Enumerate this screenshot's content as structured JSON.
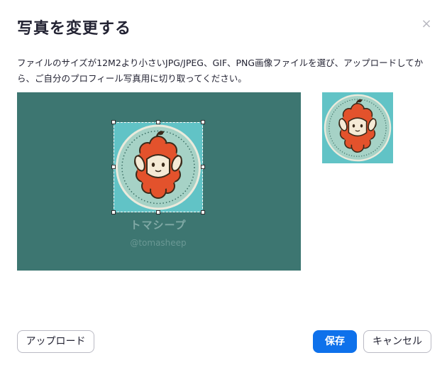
{
  "dialog": {
    "title": "写真を変更する",
    "close_symbol": "×",
    "description": "ファイルのサイズが12M2より小さいJPG/JPEG、GIF、PNG画像ファイルを選び、アップロードしてから、ご自分のプロフィール写真用に切り取ってください。"
  },
  "image": {
    "brand_name": "トマシープ",
    "brand_handle": "@tomasheep"
  },
  "buttons": {
    "upload": "アップロード",
    "save": "保存",
    "cancel": "キャンセル"
  },
  "colors": {
    "primary": "#0e71eb",
    "crop_background": "#3d7671",
    "avatar_background": "#61c3c6"
  }
}
